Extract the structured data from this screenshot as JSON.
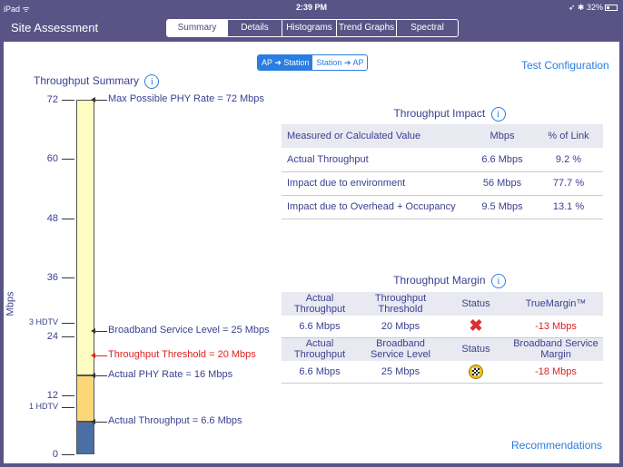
{
  "status_bar": {
    "carrier": "iPad ᯤ",
    "time": "2:39 PM",
    "right": "➶ ✱ 32%"
  },
  "nav": {
    "title": "Site Assessment",
    "tabs": [
      "Summary",
      "Details",
      "Histograms",
      "Trend Graphs",
      "Spectral"
    ],
    "active_tab": "Summary"
  },
  "direction": {
    "options": [
      "AP ➔ Station",
      "Station ➔ AP"
    ],
    "active": "AP ➔ Station"
  },
  "links": {
    "test_configuration": "Test Configuration",
    "recommendations": "Recommendations"
  },
  "throughput_summary": {
    "title": "Throughput Summary",
    "info_glyph": "i",
    "y_axis_label": "Mbps",
    "y_ticks": [
      "72",
      "60",
      "48",
      "36",
      "24",
      "12",
      "0"
    ],
    "ref_ticks": [
      "3 HDTV",
      "1 HDTV"
    ],
    "markers": [
      "Max Possible PHY Rate = 72 Mbps",
      "Broadband Service Level = 25 Mbps",
      "Throughput Threshold = 20 Mbps",
      "Actual PHY Rate = 16 Mbps",
      "Actual Throughput = 6.6 Mbps"
    ]
  },
  "chart_data": {
    "type": "bar",
    "ylabel": "Mbps",
    "ylim": [
      0,
      72
    ],
    "y_ticks": [
      0,
      12,
      24,
      36,
      48,
      60,
      72
    ],
    "reference_lines": [
      {
        "label": "3 HDTV",
        "value": 25
      },
      {
        "label": "1 HDTV",
        "value": 8.5
      }
    ],
    "segments": [
      {
        "name": "Actual Throughput",
        "from": 0,
        "to": 6.6,
        "color": "#4a6fa5"
      },
      {
        "name": "Actual PHY Rate",
        "from": 6.6,
        "to": 16,
        "color": "#fbd778"
      },
      {
        "name": "Max Possible PHY Rate",
        "from": 16,
        "to": 72,
        "color": "#fefcc0"
      }
    ],
    "markers": [
      {
        "label": "Max Possible PHY Rate = 72 Mbps",
        "value": 72
      },
      {
        "label": "Broadband Service Level = 25 Mbps",
        "value": 25
      },
      {
        "label": "Throughput Threshold = 20 Mbps",
        "value": 20,
        "color": "#e02020"
      },
      {
        "label": "Actual PHY Rate = 16 Mbps",
        "value": 16
      },
      {
        "label": "Actual Throughput = 6.6 Mbps",
        "value": 6.6
      }
    ]
  },
  "impact": {
    "title": "Throughput Impact",
    "headers": [
      "Measured or Calculated Value",
      "Mbps",
      "% of Link"
    ],
    "rows": [
      [
        "Actual Throughput",
        "6.6 Mbps",
        "9.2 %"
      ],
      [
        "Impact due to environment",
        "56 Mbps",
        "77.7 %"
      ],
      [
        "Impact due to Overhead + Occupancy",
        "9.5 Mbps",
        "13.1 %"
      ]
    ]
  },
  "margin": {
    "title": "Throughput Margin",
    "header1": [
      "Actual Throughput",
      "Throughput Threshold",
      "Status",
      "TrueMargin™"
    ],
    "row1": [
      "6.6 Mbps",
      "20 Mbps",
      "-13 Mbps"
    ],
    "status1_icon": "red-x-icon",
    "header2": [
      "Actual Throughput",
      "Broadband Service Level",
      "Status",
      "Broadband Service Margin"
    ],
    "row2": [
      "6.6 Mbps",
      "25 Mbps",
      "-18 Mbps"
    ],
    "status2_icon": "checkered-flag-icon",
    "accent_red": "#e02020",
    "link_blue": "#2a7de1"
  }
}
